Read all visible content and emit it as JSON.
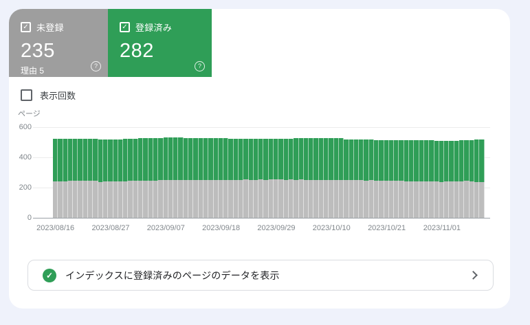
{
  "status_cards": {
    "unregistered": {
      "label": "未登録",
      "value": "235",
      "reason": "理由 5",
      "color": "#9e9e9e",
      "checked": true
    },
    "registered": {
      "label": "登録済み",
      "value": "282",
      "color": "#2f9e57",
      "checked": true
    }
  },
  "impressions_toggle": {
    "label": "表示回数",
    "checked": false
  },
  "chart_data": {
    "type": "bar",
    "stacked": true,
    "title": "",
    "ylabel": "ページ",
    "xlabel": "",
    "ylim": [
      0,
      600
    ],
    "yticks": [
      0,
      200,
      400,
      600
    ],
    "grid": "horizontal",
    "legend_position": "none",
    "days": 86,
    "x_start_date": "2023/08/16",
    "x_end_date": "2023/11/09",
    "xtick_labels": [
      "2023/08/16",
      "2023/08/27",
      "2023/09/07",
      "2023/09/18",
      "2023/09/29",
      "2023/10/10",
      "2023/10/21",
      "2023/11/01"
    ],
    "xtick_day_indices": [
      0,
      11,
      22,
      33,
      44,
      55,
      66,
      77
    ],
    "series": [
      {
        "name": "未登録",
        "color": "#bdbdbd",
        "values": [
          240,
          240,
          241,
          245,
          246,
          245,
          246,
          245,
          244,
          238,
          239,
          239,
          240,
          240,
          243,
          244,
          244,
          246,
          246,
          247,
          247,
          248,
          248,
          249,
          248,
          249,
          250,
          250,
          250,
          251,
          250,
          251,
          252,
          251,
          252,
          252,
          251,
          252,
          253,
          252,
          252,
          253,
          252,
          253,
          254,
          253,
          252,
          253,
          252,
          253,
          252,
          251,
          252,
          251,
          250,
          251,
          250,
          250,
          249,
          248,
          249,
          248,
          247,
          248,
          247,
          246,
          247,
          246,
          245,
          246,
          243,
          242,
          241,
          242,
          241,
          242,
          239,
          238,
          239,
          240,
          241,
          243,
          244,
          243,
          236,
          235
        ]
      },
      {
        "name": "登録済み",
        "color": "#2f9e57",
        "values": [
          282,
          282,
          281,
          278,
          277,
          278,
          277,
          278,
          279,
          282,
          281,
          281,
          280,
          280,
          281,
          280,
          280,
          280,
          280,
          279,
          279,
          278,
          282,
          282,
          282,
          282,
          279,
          278,
          276,
          275,
          276,
          275,
          274,
          275,
          274,
          270,
          271,
          270,
          269,
          270,
          270,
          271,
          272,
          271,
          270,
          271,
          272,
          271,
          274,
          273,
          274,
          275,
          274,
          278,
          279,
          278,
          279,
          279,
          269,
          270,
          269,
          270,
          271,
          270,
          269,
          270,
          269,
          270,
          271,
          270,
          270,
          271,
          272,
          271,
          272,
          271,
          272,
          273,
          272,
          271,
          270,
          273,
          272,
          273,
          281,
          282
        ]
      }
    ]
  },
  "cta": {
    "label": "インデックスに登録済みのページのデータを表示",
    "status_icon": "check-circle",
    "status_color": "#2f9e57"
  },
  "y_axis_labels_desc": [
    "600",
    "400",
    "200",
    "0"
  ]
}
